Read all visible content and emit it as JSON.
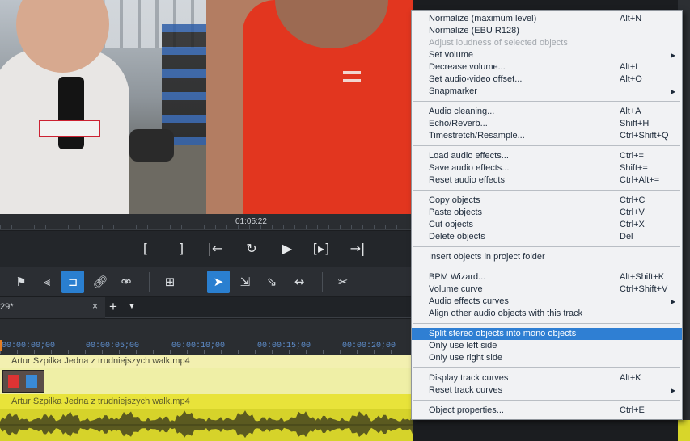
{
  "preview": {
    "timecode": "01:05:22"
  },
  "transport": {
    "in_mark": "[",
    "out_mark": "]",
    "prev_icon": "|←",
    "loop_icon": "↻",
    "play_icon": "▶",
    "range_icon": "[▸]",
    "next_icon": "→|"
  },
  "toolbar": {
    "tools": [
      "flag-icon",
      "mixer-icon",
      "snap-icon",
      "link-icon",
      "unlink-icon",
      "insert-icon",
      "pointer-icon",
      "select-track-icon",
      "select-right-icon",
      "stretch-icon",
      "scissors-icon"
    ]
  },
  "tabs": {
    "project_tab": "29*",
    "close": "×",
    "add": "+",
    "menu": "▼"
  },
  "timeline": {
    "ticks": [
      "00:00:00;00",
      "00:00:05;00",
      "00:00:10;00",
      "00:00:15;00",
      "00:00:20;00"
    ]
  },
  "tracks": {
    "video_clip": "Artur Szpilka Jedna z trudniejszych walk.mp4",
    "audio_clip": "Artur Szpilka Jedna z trudniejszych walk.mp4"
  },
  "menu": {
    "groups": [
      [
        {
          "label": "Normalize (maximum level)",
          "shortcut": "Alt+N"
        },
        {
          "label": "Normalize (EBU R128)",
          "shortcut": ""
        },
        {
          "label": "Adjust loudness of selected objects",
          "shortcut": "",
          "disabled": true
        },
        {
          "label": "Set volume",
          "shortcut": "",
          "submenu": true
        },
        {
          "label": "Decrease volume...",
          "shortcut": "Alt+L"
        },
        {
          "label": "Set audio-video offset...",
          "shortcut": "Alt+O"
        },
        {
          "label": "Snapmarker",
          "shortcut": "",
          "submenu": true
        }
      ],
      [
        {
          "label": "Audio cleaning...",
          "shortcut": "Alt+A"
        },
        {
          "label": "Echo/Reverb...",
          "shortcut": "Shift+H"
        },
        {
          "label": "Timestretch/Resample...",
          "shortcut": "Ctrl+Shift+Q"
        }
      ],
      [
        {
          "label": "Load audio effects...",
          "shortcut": "Ctrl+="
        },
        {
          "label": "Save audio effects...",
          "shortcut": "Shift+="
        },
        {
          "label": "Reset audio effects",
          "shortcut": "Ctrl+Alt+="
        }
      ],
      [
        {
          "label": "Copy objects",
          "shortcut": "Ctrl+C"
        },
        {
          "label": "Paste objects",
          "shortcut": "Ctrl+V"
        },
        {
          "label": "Cut objects",
          "shortcut": "Ctrl+X"
        },
        {
          "label": "Delete objects",
          "shortcut": "Del"
        }
      ],
      [
        {
          "label": "Insert objects in project folder",
          "shortcut": ""
        }
      ],
      [
        {
          "label": "BPM Wizard...",
          "shortcut": "Alt+Shift+K"
        },
        {
          "label": "Volume curve",
          "shortcut": "Ctrl+Shift+V"
        },
        {
          "label": "Audio effects curves",
          "shortcut": "",
          "submenu": true
        },
        {
          "label": "Align other audio objects with this track",
          "shortcut": ""
        }
      ],
      [
        {
          "label": "Split stereo objects into mono objects",
          "shortcut": "",
          "highlighted": true
        },
        {
          "label": "Only use left side",
          "shortcut": ""
        },
        {
          "label": "Only use right side",
          "shortcut": ""
        }
      ],
      [
        {
          "label": "Display track curves",
          "shortcut": "Alt+K"
        },
        {
          "label": "Reset track curves",
          "shortcut": "",
          "submenu": true
        }
      ],
      [
        {
          "label": "Object properties...",
          "shortcut": "Ctrl+E"
        }
      ]
    ]
  }
}
